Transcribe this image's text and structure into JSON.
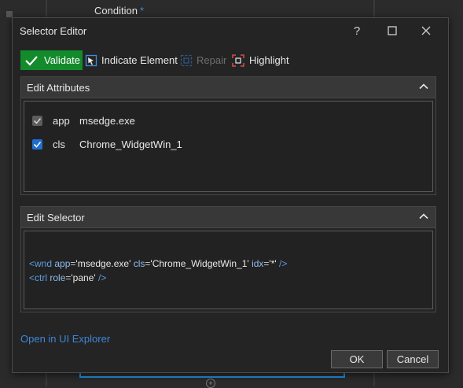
{
  "background": {
    "condition_label": "Condition",
    "required_marker": "*"
  },
  "dialog": {
    "title": "Selector Editor",
    "controls": {
      "help": "?",
      "maximize": "□",
      "close": "✕"
    }
  },
  "toolbar": {
    "validate": "Validate",
    "indicate": "Indicate Element",
    "repair": "Repair",
    "highlight": "Highlight"
  },
  "edit_attributes": {
    "header": "Edit Attributes",
    "rows": [
      {
        "checked": true,
        "enabled": false,
        "name": "app",
        "value": "msedge.exe"
      },
      {
        "checked": true,
        "enabled": true,
        "name": "cls",
        "value": "Chrome_WidgetWin_1"
      }
    ]
  },
  "edit_selector": {
    "header": "Edit Selector",
    "line1": {
      "open": "<",
      "tag": "wnd",
      "attr1": "app",
      "val1": "'msedge.exe'",
      "attr2": "cls",
      "val2": "'Chrome_WidgetWin_1'",
      "attr3": "idx",
      "val3": "'*'",
      "close": "/>"
    },
    "line2": {
      "open": "<",
      "tag": "ctrl",
      "attr1": "role",
      "val1": "'pane'",
      "close": "/>"
    },
    "eq": "="
  },
  "footer": {
    "link": "Open in UI Explorer",
    "ok": "OK",
    "cancel": "Cancel"
  },
  "colors": {
    "validate_bg": "#138b2c",
    "accent_blue": "#1e8fe0",
    "link": "#3d86d6"
  }
}
